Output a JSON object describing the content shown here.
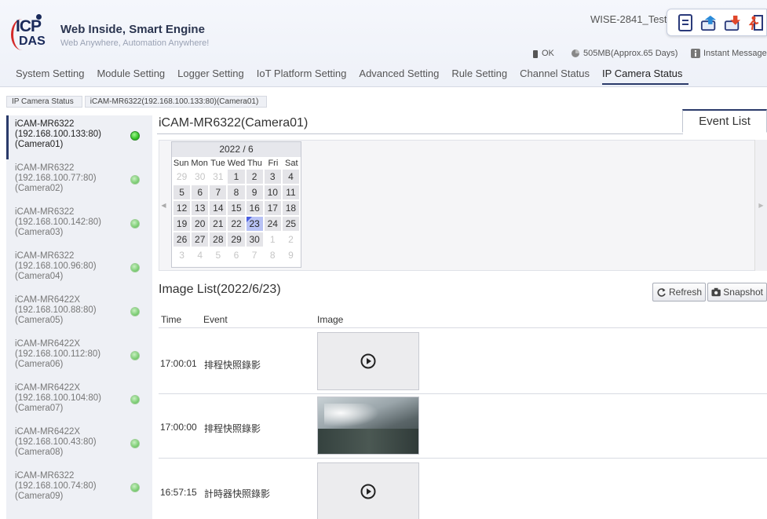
{
  "header": {
    "tagline": "Web Inside, Smart Engine",
    "subtagline": "Web Anywhere, Automation Anywhere!",
    "device_name": "WISE-2841_Test",
    "logo_top": "ICP",
    "logo_bottom": "DAS",
    "status_ok": "OK",
    "storage": "505MB(Approx.65 Days)",
    "instant_message": "Instant Message"
  },
  "nav": {
    "items": [
      "System Setting",
      "Module Setting",
      "Logger Setting",
      "IoT Platform Setting",
      "Advanced Setting",
      "Rule Setting",
      "Channel Status",
      "IP Camera Status"
    ],
    "active": "IP Camera Status"
  },
  "breadcrumb": {
    "root": "IP Camera Status",
    "current": "iCAM-MR6322(192.168.100.133:80)(Camera01)"
  },
  "cameras": [
    {
      "model": "iCAM-MR6322",
      "addr": "(192.168.100.133:80)",
      "name": "(Camera01)"
    },
    {
      "model": "iCAM-MR6322",
      "addr": "(192.168.100.77:80)",
      "name": "(Camera02)"
    },
    {
      "model": "iCAM-MR6322",
      "addr": "(192.168.100.142:80)",
      "name": "(Camera03)"
    },
    {
      "model": "iCAM-MR6322",
      "addr": "(192.168.100.96:80)",
      "name": "(Camera04)"
    },
    {
      "model": "iCAM-MR6422X",
      "addr": "(192.168.100.88:80)",
      "name": "(Camera05)"
    },
    {
      "model": "iCAM-MR6422X",
      "addr": "(192.168.100.112:80)",
      "name": "(Camera06)"
    },
    {
      "model": "iCAM-MR6422X",
      "addr": "(192.168.100.104:80)",
      "name": "(Camera07)"
    },
    {
      "model": "iCAM-MR6422X",
      "addr": "(192.168.100.43:80)",
      "name": "(Camera08)"
    },
    {
      "model": "iCAM-MR6322",
      "addr": "(192.168.100.74:80)",
      "name": "(Camera09)"
    }
  ],
  "main": {
    "title": "iCAM-MR6322(Camera01)",
    "event_tab": "Event List",
    "calendar": {
      "header": "2022 / 6",
      "dow": [
        "Sun",
        "Mon",
        "Tue",
        "Wed",
        "Thu",
        "Fri",
        "Sat"
      ],
      "days": [
        [
          "29",
          "30",
          "31",
          "1",
          "2",
          "3",
          "4"
        ],
        [
          "5",
          "6",
          "7",
          "8",
          "9",
          "10",
          "11"
        ],
        [
          "12",
          "13",
          "14",
          "15",
          "16",
          "17",
          "18"
        ],
        [
          "19",
          "20",
          "21",
          "22",
          "23",
          "24",
          "25"
        ],
        [
          "26",
          "27",
          "28",
          "29",
          "30",
          "1",
          "2"
        ],
        [
          "3",
          "4",
          "5",
          "6",
          "7",
          "8",
          "9"
        ]
      ],
      "selected": "23"
    },
    "list_title": "Image List(2022/6/23)",
    "refresh_label": "Refresh",
    "snapshot_label": "Snapshot",
    "columns": {
      "time": "Time",
      "event": "Event",
      "image": "Image"
    },
    "rows": [
      {
        "time": "17:00:01",
        "event": "排程快照錄影",
        "image": "video"
      },
      {
        "time": "17:00:00",
        "event": "排程快照錄影",
        "image": "photo"
      },
      {
        "time": "16:57:15",
        "event": "計時器快照錄影",
        "image": "video"
      }
    ]
  }
}
